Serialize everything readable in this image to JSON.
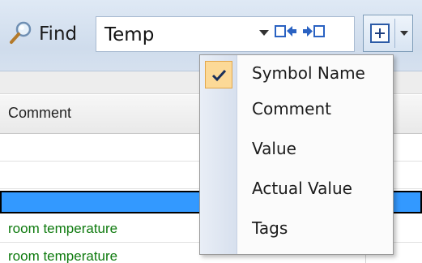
{
  "toolbar": {
    "find_label": "Find",
    "search_value": "Temp",
    "icons": [
      "search-icon",
      "combo-dropdown-icon",
      "find-previous-icon",
      "find-next-icon",
      "expand-icon",
      "split-dropdown-icon"
    ]
  },
  "grid": {
    "column_header": "Comment",
    "rows": [
      {
        "comment": ""
      },
      {
        "comment": ""
      },
      {
        "comment": "",
        "selected": true
      },
      {
        "comment": "room temperature"
      },
      {
        "comment": "room temperature"
      }
    ],
    "comment_color": "#0e7a0e",
    "selection_color": "#3399ff"
  },
  "menu": {
    "items": [
      {
        "label": "Symbol Name",
        "checked": true
      },
      {
        "label": "Comment",
        "checked": false
      },
      {
        "label": "Value",
        "checked": false
      },
      {
        "label": "Actual Value",
        "checked": false
      },
      {
        "label": "Tags",
        "checked": false
      }
    ],
    "check_highlight": "#fcd997"
  }
}
